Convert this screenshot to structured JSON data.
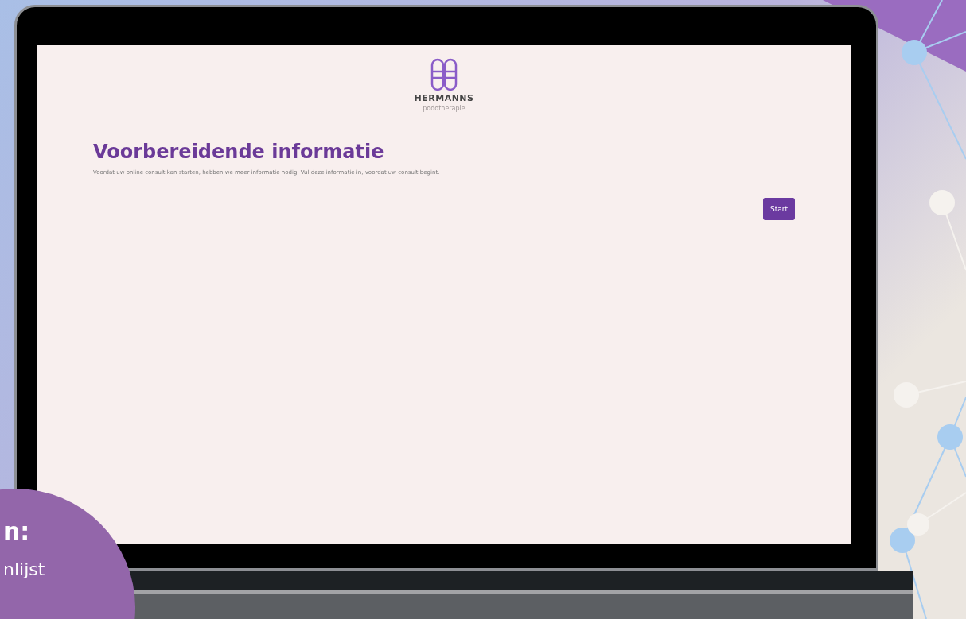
{
  "logo": {
    "name": "HERMANNS",
    "tagline": "podotherapie"
  },
  "page": {
    "title": "Voorbereidende informatie",
    "description": "Voordat uw online consult kan starten, hebben we meer informatie nodig. Vul deze informatie in, voordat uw consult begint."
  },
  "start_button": {
    "label": "Start"
  },
  "overlay_badge": {
    "lines": [
      "n:",
      "nlijst"
    ]
  }
}
